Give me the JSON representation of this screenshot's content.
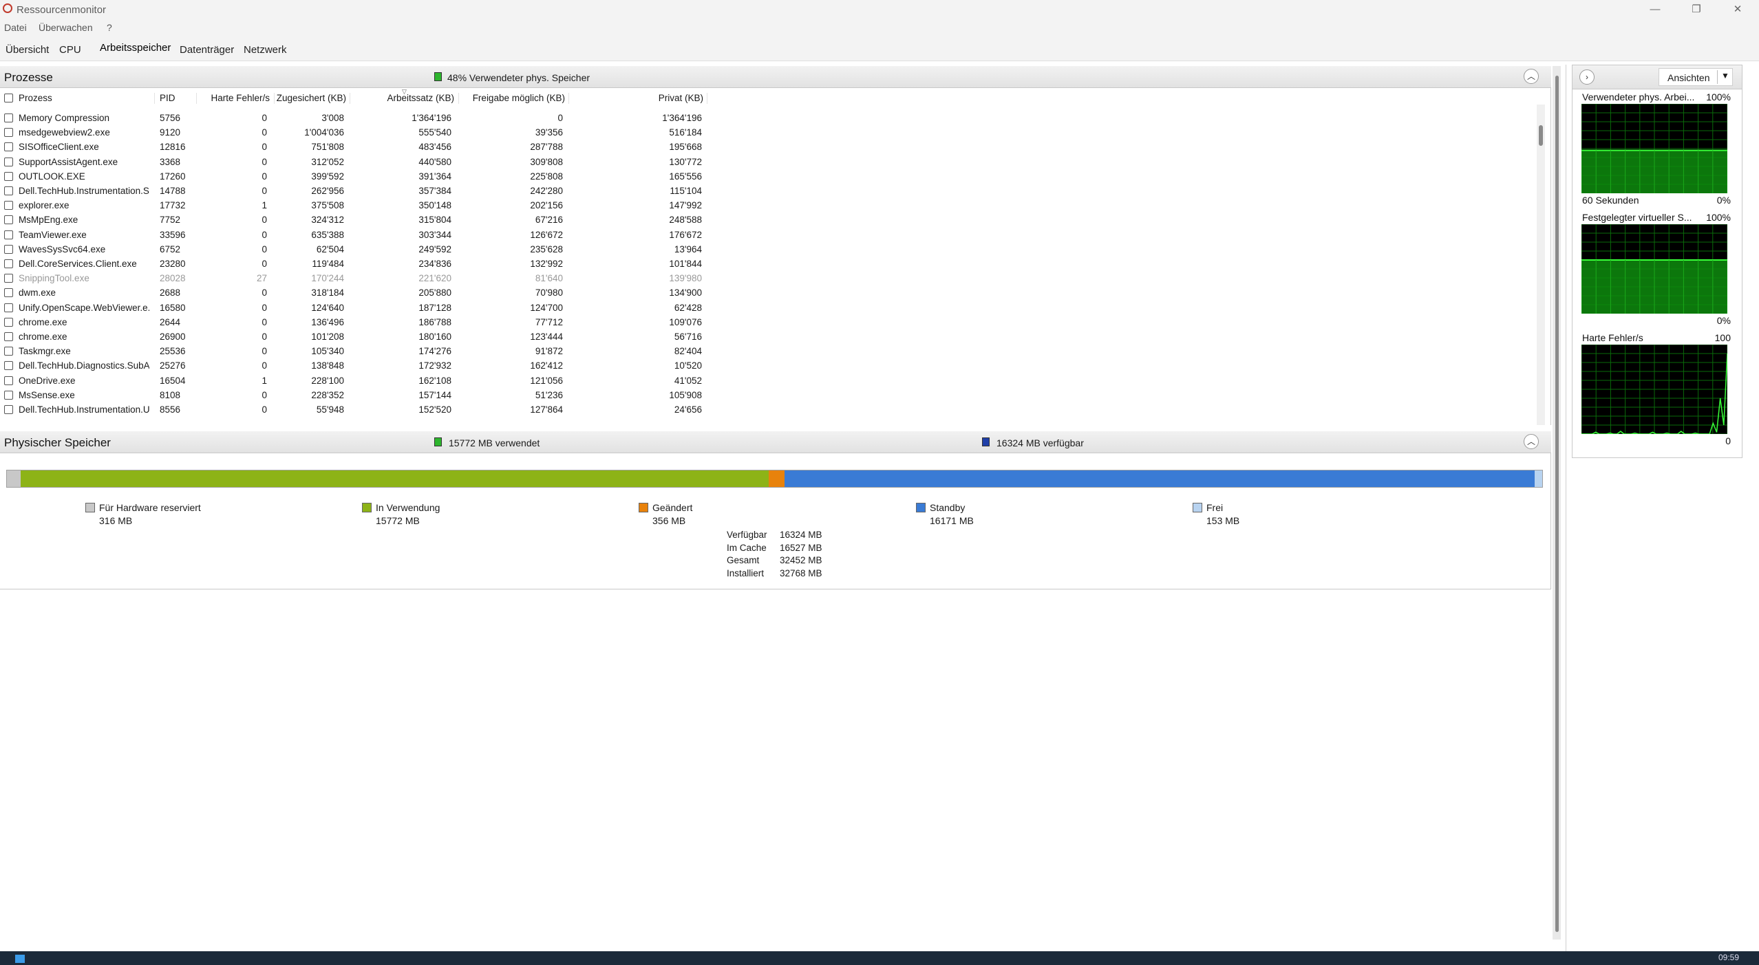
{
  "window": {
    "title": "Ressourcenmonitor",
    "minimize": "—",
    "maximize": "❐",
    "close": "✕"
  },
  "menu": [
    "Datei",
    "Überwachen",
    "?"
  ],
  "tabs": [
    "Übersicht",
    "CPU",
    "Arbeitsspeicher",
    "Datenträger",
    "Netzwerk"
  ],
  "processes": {
    "title": "Prozesse",
    "summary": "48% Verwendeter phys. Speicher",
    "columns": [
      "Prozess",
      "PID",
      "Harte Fehler/s",
      "Zugesichert (KB)",
      "Arbeitssatz (KB)",
      "Freigabe möglich (KB)",
      "Privat (KB)"
    ],
    "rows": [
      [
        "Memory Compression",
        "5756",
        "0",
        "3'008",
        "1'364'196",
        "0",
        "1'364'196"
      ],
      [
        "msedgewebview2.exe",
        "9120",
        "0",
        "1'004'036",
        "555'540",
        "39'356",
        "516'184"
      ],
      [
        "SISOfficeClient.exe",
        "12816",
        "0",
        "751'808",
        "483'456",
        "287'788",
        "195'668"
      ],
      [
        "SupportAssistAgent.exe",
        "3368",
        "0",
        "312'052",
        "440'580",
        "309'808",
        "130'772"
      ],
      [
        "OUTLOOK.EXE",
        "17260",
        "0",
        "399'592",
        "391'364",
        "225'808",
        "165'556"
      ],
      [
        "Dell.TechHub.Instrumentation.S...",
        "14788",
        "0",
        "262'956",
        "357'384",
        "242'280",
        "115'104"
      ],
      [
        "explorer.exe",
        "17732",
        "1",
        "375'508",
        "350'148",
        "202'156",
        "147'992"
      ],
      [
        "MsMpEng.exe",
        "7752",
        "0",
        "324'312",
        "315'804",
        "67'216",
        "248'588"
      ],
      [
        "TeamViewer.exe",
        "33596",
        "0",
        "635'388",
        "303'344",
        "126'672",
        "176'672"
      ],
      [
        "WavesSysSvc64.exe",
        "6752",
        "0",
        "62'504",
        "249'592",
        "235'628",
        "13'964"
      ],
      [
        "Dell.CoreServices.Client.exe",
        "23280",
        "0",
        "119'484",
        "234'836",
        "132'992",
        "101'844"
      ],
      [
        "SnippingTool.exe",
        "28028",
        "27",
        "170'244",
        "221'620",
        "81'640",
        "139'980"
      ],
      [
        "dwm.exe",
        "2688",
        "0",
        "318'184",
        "205'880",
        "70'980",
        "134'900"
      ],
      [
        "Unify.OpenScape.WebViewer.e...",
        "16580",
        "0",
        "124'640",
        "187'128",
        "124'700",
        "62'428"
      ],
      [
        "chrome.exe",
        "2644",
        "0",
        "136'496",
        "186'788",
        "77'712",
        "109'076"
      ],
      [
        "chrome.exe",
        "26900",
        "0",
        "101'208",
        "180'160",
        "123'444",
        "56'716"
      ],
      [
        "Taskmgr.exe",
        "25536",
        "0",
        "105'340",
        "174'276",
        "91'872",
        "82'404"
      ],
      [
        "Dell.TechHub.Diagnostics.SubAg...",
        "25276",
        "0",
        "138'848",
        "172'932",
        "162'412",
        "10'520"
      ],
      [
        "OneDrive.exe",
        "16504",
        "1",
        "228'100",
        "162'108",
        "121'056",
        "41'052"
      ],
      [
        "MsSense.exe",
        "8108",
        "0",
        "228'352",
        "157'144",
        "51'236",
        "105'908"
      ],
      [
        "Dell.TechHub.Instrumentation.U...",
        "8556",
        "0",
        "55'948",
        "152'520",
        "127'864",
        "24'656"
      ]
    ]
  },
  "physical": {
    "title": "Physischer Speicher",
    "used_summary": "15772 MB verwendet",
    "avail_summary": "16324 MB verfügbar",
    "legend": [
      {
        "label": "Für Hardware reserviert",
        "value": "316 MB",
        "color": "#c8c8c8"
      },
      {
        "label": "In Verwendung",
        "value": "15772 MB",
        "color": "#8db317"
      },
      {
        "label": "Geändert",
        "value": "356 MB",
        "color": "#e8820c"
      },
      {
        "label": "Standby",
        "value": "16171 MB",
        "color": "#3a7bd5"
      },
      {
        "label": "Frei",
        "value": "153 MB",
        "color": "#b8d3f0"
      }
    ],
    "stats": [
      {
        "label": "Verfügbar",
        "value": "16324 MB"
      },
      {
        "label": "Im Cache",
        "value": "16527 MB"
      },
      {
        "label": "Gesamt",
        "value": "32452 MB"
      },
      {
        "label": "Installiert",
        "value": "32768 MB"
      }
    ]
  },
  "sidebar": {
    "views_button": "Ansichten",
    "graphs": [
      {
        "title": "Verwendeter phys. Arbei...",
        "max": "100%",
        "footer_left": "60 Sekunden",
        "footer_right": "0%"
      },
      {
        "title": "Festgelegter virtueller S...",
        "max": "100%",
        "footer_left": "",
        "footer_right": "0%"
      },
      {
        "title": "Harte Fehler/s",
        "max": "100",
        "footer_left": "",
        "footer_right": "0"
      }
    ]
  },
  "taskbar": {
    "time": "09:59"
  }
}
